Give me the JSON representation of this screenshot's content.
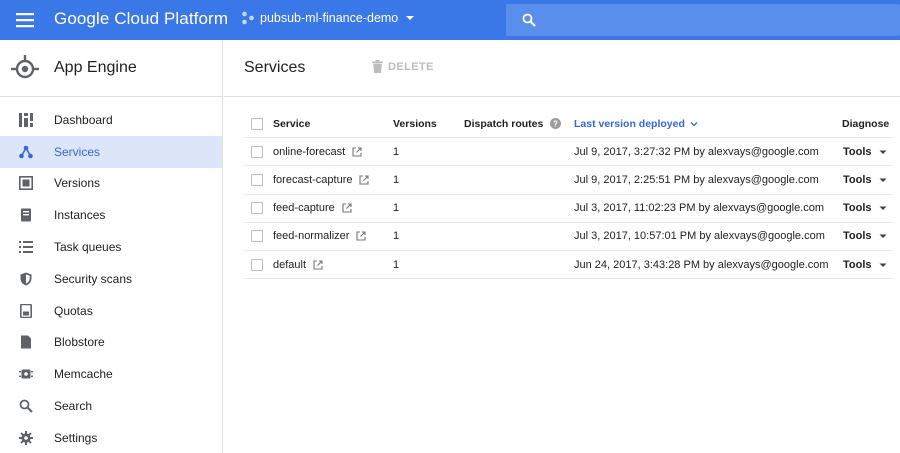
{
  "topbar": {
    "brand": "Google Cloud Platform",
    "project": "pubsub-ml-finance-demo",
    "menu_icon": "hamburger-menu-icon",
    "search_icon": "search-icon"
  },
  "sidebar": {
    "title": "App Engine",
    "items": [
      {
        "label": "Dashboard",
        "icon": "dashboard-icon"
      },
      {
        "label": "Services",
        "icon": "services-icon",
        "active": true
      },
      {
        "label": "Versions",
        "icon": "versions-icon"
      },
      {
        "label": "Instances",
        "icon": "instances-icon"
      },
      {
        "label": "Task queues",
        "icon": "list-icon"
      },
      {
        "label": "Security scans",
        "icon": "shield-icon"
      },
      {
        "label": "Quotas",
        "icon": "quota-icon"
      },
      {
        "label": "Blobstore",
        "icon": "file-icon"
      },
      {
        "label": "Memcache",
        "icon": "chip-icon"
      },
      {
        "label": "Search",
        "icon": "search-icon"
      },
      {
        "label": "Settings",
        "icon": "gear-icon"
      }
    ]
  },
  "main": {
    "title": "Services",
    "delete_label": "DELETE",
    "table": {
      "headers": {
        "service": "Service",
        "versions": "Versions",
        "dispatch": "Dispatch routes",
        "deployed": "Last version deployed",
        "diagnose": "Diagnose"
      },
      "rows": [
        {
          "service": "online-forecast",
          "versions": "1",
          "deployed": "Jul 9, 2017, 3:27:32 PM by alexvays@google.com",
          "tools": "Tools"
        },
        {
          "service": "forecast-capture",
          "versions": "1",
          "deployed": "Jul 9, 2017, 2:25:51 PM by alexvays@google.com",
          "tools": "Tools"
        },
        {
          "service": "feed-capture",
          "versions": "1",
          "deployed": "Jul 3, 2017, 11:02:23 PM by alexvays@google.com",
          "tools": "Tools"
        },
        {
          "service": "feed-normalizer",
          "versions": "1",
          "deployed": "Jul 3, 2017, 10:57:01 PM by alexvays@google.com",
          "tools": "Tools"
        },
        {
          "service": "default",
          "versions": "1",
          "deployed": "Jun 24, 2017, 3:43:28 PM by alexvays@google.com",
          "tools": "Tools"
        }
      ]
    }
  },
  "colors": {
    "topbar": "#3b78e7",
    "search": "#5a8eec",
    "active_bg": "#dde6f8",
    "accent": "#3367d6",
    "icon_gray": "#5f6368"
  }
}
